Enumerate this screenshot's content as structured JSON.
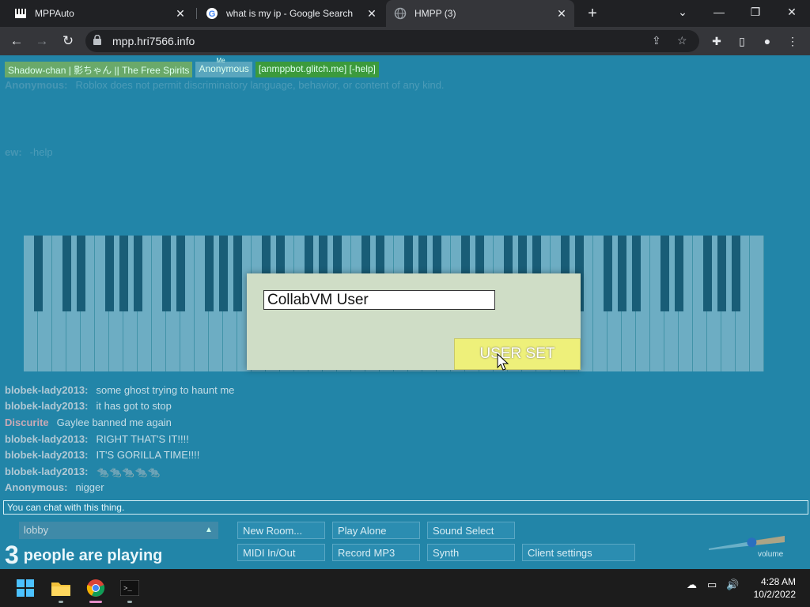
{
  "browser": {
    "tabs": [
      {
        "title": "MPPAuto",
        "icon": "piano-icon"
      },
      {
        "title": "what is my ip - Google Search",
        "icon": "google-icon"
      },
      {
        "title": "HMPP (3)",
        "icon": "globe-icon"
      }
    ],
    "url": "mpp.hri7566.info"
  },
  "page": {
    "participants": [
      {
        "name": "Shadow-chan | 影ちゃん || The Free Spirits",
        "color": "#6aa96a"
      },
      {
        "name": "Anonymous",
        "color": "#5aa6be",
        "badge": "Me"
      },
      {
        "name": "[anmppbot.glitch.me] [-help]",
        "color": "#3c9a3c"
      }
    ],
    "chat_top": [
      {
        "who": "Anonymous:",
        "msg": "Roblox does not permit discriminatory language, behavior, or content of any kind."
      },
      {
        "who": "ew:",
        "msg": "-help"
      },
      {
        "who": "blobek-lady2013:",
        "msg": "some ghost trying to haunt me"
      },
      {
        "who": "blobek-lady2013:",
        "msg": "it has got to stop"
      },
      {
        "who": "Discurite",
        "msg": "Gaylee banned me again"
      },
      {
        "who": "blobek-lady2013:",
        "msg": "RIGHT THAT'S IT!!!!"
      },
      {
        "who": "blobek-lady2013:",
        "msg": "IT'S GORILLA TIME!!!!"
      },
      {
        "who": "blobek-lady2013:",
        "msg": "🐀🐀🐀🐀🐀"
      },
      {
        "who": "Anonymous:",
        "msg": "nigger"
      }
    ],
    "dialog": {
      "input_value": "CollabVM User",
      "button_label": "USER SET"
    },
    "chat_input_placeholder": "You can chat with this thing.",
    "room": "lobby",
    "playing_count": "3",
    "playing_text": "people are playing",
    "buttons": {
      "new_room": "New Room...",
      "play_alone": "Play Alone",
      "sound_select": "Sound Select",
      "midi": "MIDI In/Out",
      "record": "Record MP3",
      "synth": "Synth",
      "client_settings": "Client settings"
    },
    "volume_label": "volume",
    "volume_level": 0.55
  },
  "taskbar": {
    "time": "4:28 AM",
    "date": "10/2/2022"
  }
}
